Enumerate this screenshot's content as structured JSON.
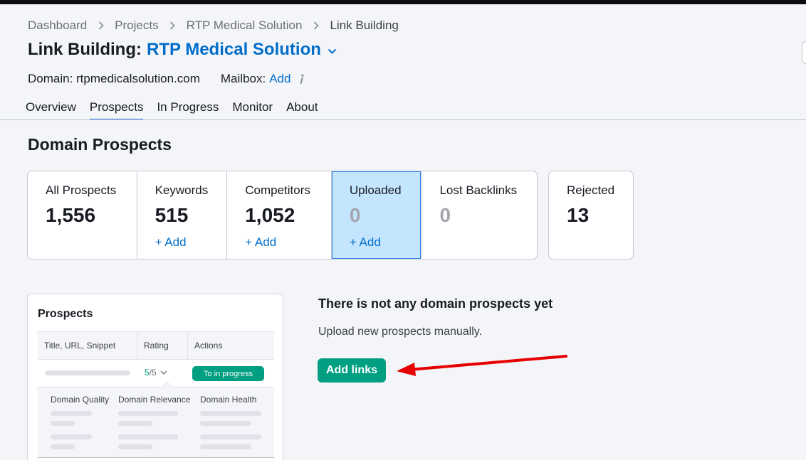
{
  "breadcrumb": [
    {
      "label": "Dashboard"
    },
    {
      "label": "Projects"
    },
    {
      "label": "RTP Medical Solution"
    },
    {
      "label": "Link Building"
    }
  ],
  "header": {
    "title_prefix": "Link Building:",
    "project_name": "RTP Medical Solution",
    "domain_label": "Domain: rtpmedicalsolution.com",
    "mailbox_label": "Mailbox:",
    "mailbox_add": "Add"
  },
  "tabs": [
    {
      "label": "Overview",
      "active": false
    },
    {
      "label": "Prospects",
      "active": true
    },
    {
      "label": "In Progress",
      "active": false
    },
    {
      "label": "Monitor",
      "active": false
    },
    {
      "label": "About",
      "active": false
    }
  ],
  "section_title": "Domain Prospects",
  "stats": [
    {
      "label": "All Prospects",
      "value": "1,556"
    },
    {
      "label": "Keywords",
      "value": "515",
      "add": "+ Add"
    },
    {
      "label": "Competitors",
      "value": "1,052",
      "add": "+ Add"
    },
    {
      "label": "Uploaded",
      "value": "0",
      "add": "+ Add",
      "selected": true
    },
    {
      "label": "Lost Backlinks",
      "value": "0"
    },
    {
      "label": "Rejected",
      "value": "13"
    }
  ],
  "preview": {
    "title": "Prospects",
    "columns": [
      "Title, URL, Snippet",
      "Rating",
      "Actions"
    ],
    "rating_value": "5",
    "rating_max": "/5",
    "action_label": "To in progress",
    "detail_columns": [
      "Domain Quality",
      "Domain Relevance",
      "Domain Health"
    ]
  },
  "empty_state": {
    "title": "There is not any domain prospects yet",
    "text": "Upload new prospects manually.",
    "button_label": "Add links"
  },
  "colors": {
    "accent_blue": "#006dca",
    "primary_green": "#009f81",
    "selected_bg": "#c4e5fe",
    "annotation_red": "#e60000"
  }
}
